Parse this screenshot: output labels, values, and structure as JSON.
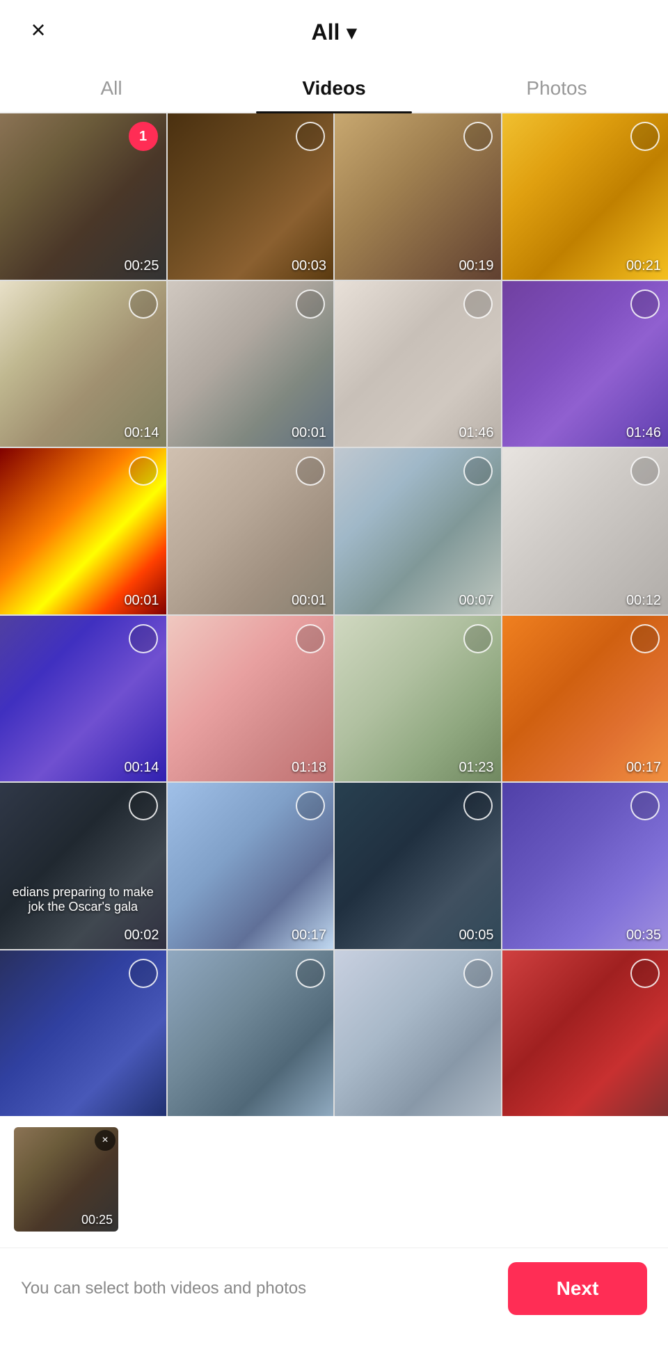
{
  "header": {
    "close_label": "×",
    "title": "All",
    "chevron": "▾"
  },
  "tabs": [
    {
      "id": "all",
      "label": "All",
      "active": false
    },
    {
      "id": "videos",
      "label": "Videos",
      "active": true
    },
    {
      "id": "photos",
      "label": "Photos",
      "active": false
    }
  ],
  "grid": {
    "items": [
      {
        "id": 1,
        "duration": "00:25",
        "selected": true,
        "badge": "1",
        "thumb_class": "thumb-1"
      },
      {
        "id": 2,
        "duration": "00:03",
        "selected": false,
        "thumb_class": "thumb-2"
      },
      {
        "id": 3,
        "duration": "00:19",
        "selected": false,
        "thumb_class": "thumb-3"
      },
      {
        "id": 4,
        "duration": "00:21",
        "selected": false,
        "thumb_class": "thumb-4"
      },
      {
        "id": 5,
        "duration": "00:14",
        "selected": false,
        "thumb_class": "thumb-5"
      },
      {
        "id": 6,
        "duration": "00:01",
        "selected": false,
        "thumb_class": "thumb-6"
      },
      {
        "id": 7,
        "duration": "01:46",
        "selected": false,
        "thumb_class": "thumb-7"
      },
      {
        "id": 8,
        "duration": "01:46",
        "selected": false,
        "thumb_class": "thumb-8"
      },
      {
        "id": 9,
        "duration": "00:01",
        "selected": false,
        "thumb_class": "thumb-9"
      },
      {
        "id": 10,
        "duration": "00:01",
        "selected": false,
        "thumb_class": "thumb-10"
      },
      {
        "id": 11,
        "duration": "00:07",
        "selected": false,
        "thumb_class": "thumb-11"
      },
      {
        "id": 12,
        "duration": "00:12",
        "selected": false,
        "thumb_class": "thumb-12"
      },
      {
        "id": 13,
        "duration": "00:14",
        "selected": false,
        "thumb_class": "thumb-13"
      },
      {
        "id": 14,
        "duration": "01:18",
        "selected": false,
        "thumb_class": "thumb-14"
      },
      {
        "id": 15,
        "duration": "01:23",
        "selected": false,
        "thumb_class": "thumb-15"
      },
      {
        "id": 16,
        "duration": "00:17",
        "selected": false,
        "thumb_class": "thumb-16"
      },
      {
        "id": 17,
        "duration": "00:02",
        "selected": false,
        "thumb_class": "thumb-17",
        "subtitle": "edians preparing to make jok the Oscar's gala"
      },
      {
        "id": 18,
        "duration": "00:17",
        "selected": false,
        "thumb_class": "thumb-18"
      },
      {
        "id": 19,
        "duration": "00:05",
        "selected": false,
        "thumb_class": "thumb-19"
      },
      {
        "id": 20,
        "duration": "00:35",
        "selected": false,
        "thumb_class": "thumb-20"
      },
      {
        "id": 21,
        "duration": "",
        "selected": false,
        "thumb_class": "thumb-21"
      },
      {
        "id": 22,
        "duration": "",
        "selected": false,
        "thumb_class": "thumb-22"
      },
      {
        "id": 23,
        "duration": "",
        "selected": false,
        "thumb_class": "thumb-23"
      },
      {
        "id": 24,
        "duration": "",
        "selected": false,
        "thumb_class": "thumb-24"
      }
    ]
  },
  "preview": {
    "show": true,
    "duration": "00:25",
    "thumb_class": "thumb-1"
  },
  "bottom_bar": {
    "hint": "You can select both videos and photos",
    "next_label": "Next"
  },
  "colors": {
    "accent": "#FF2D55",
    "tab_active": "#111111",
    "tab_inactive": "#999999"
  }
}
